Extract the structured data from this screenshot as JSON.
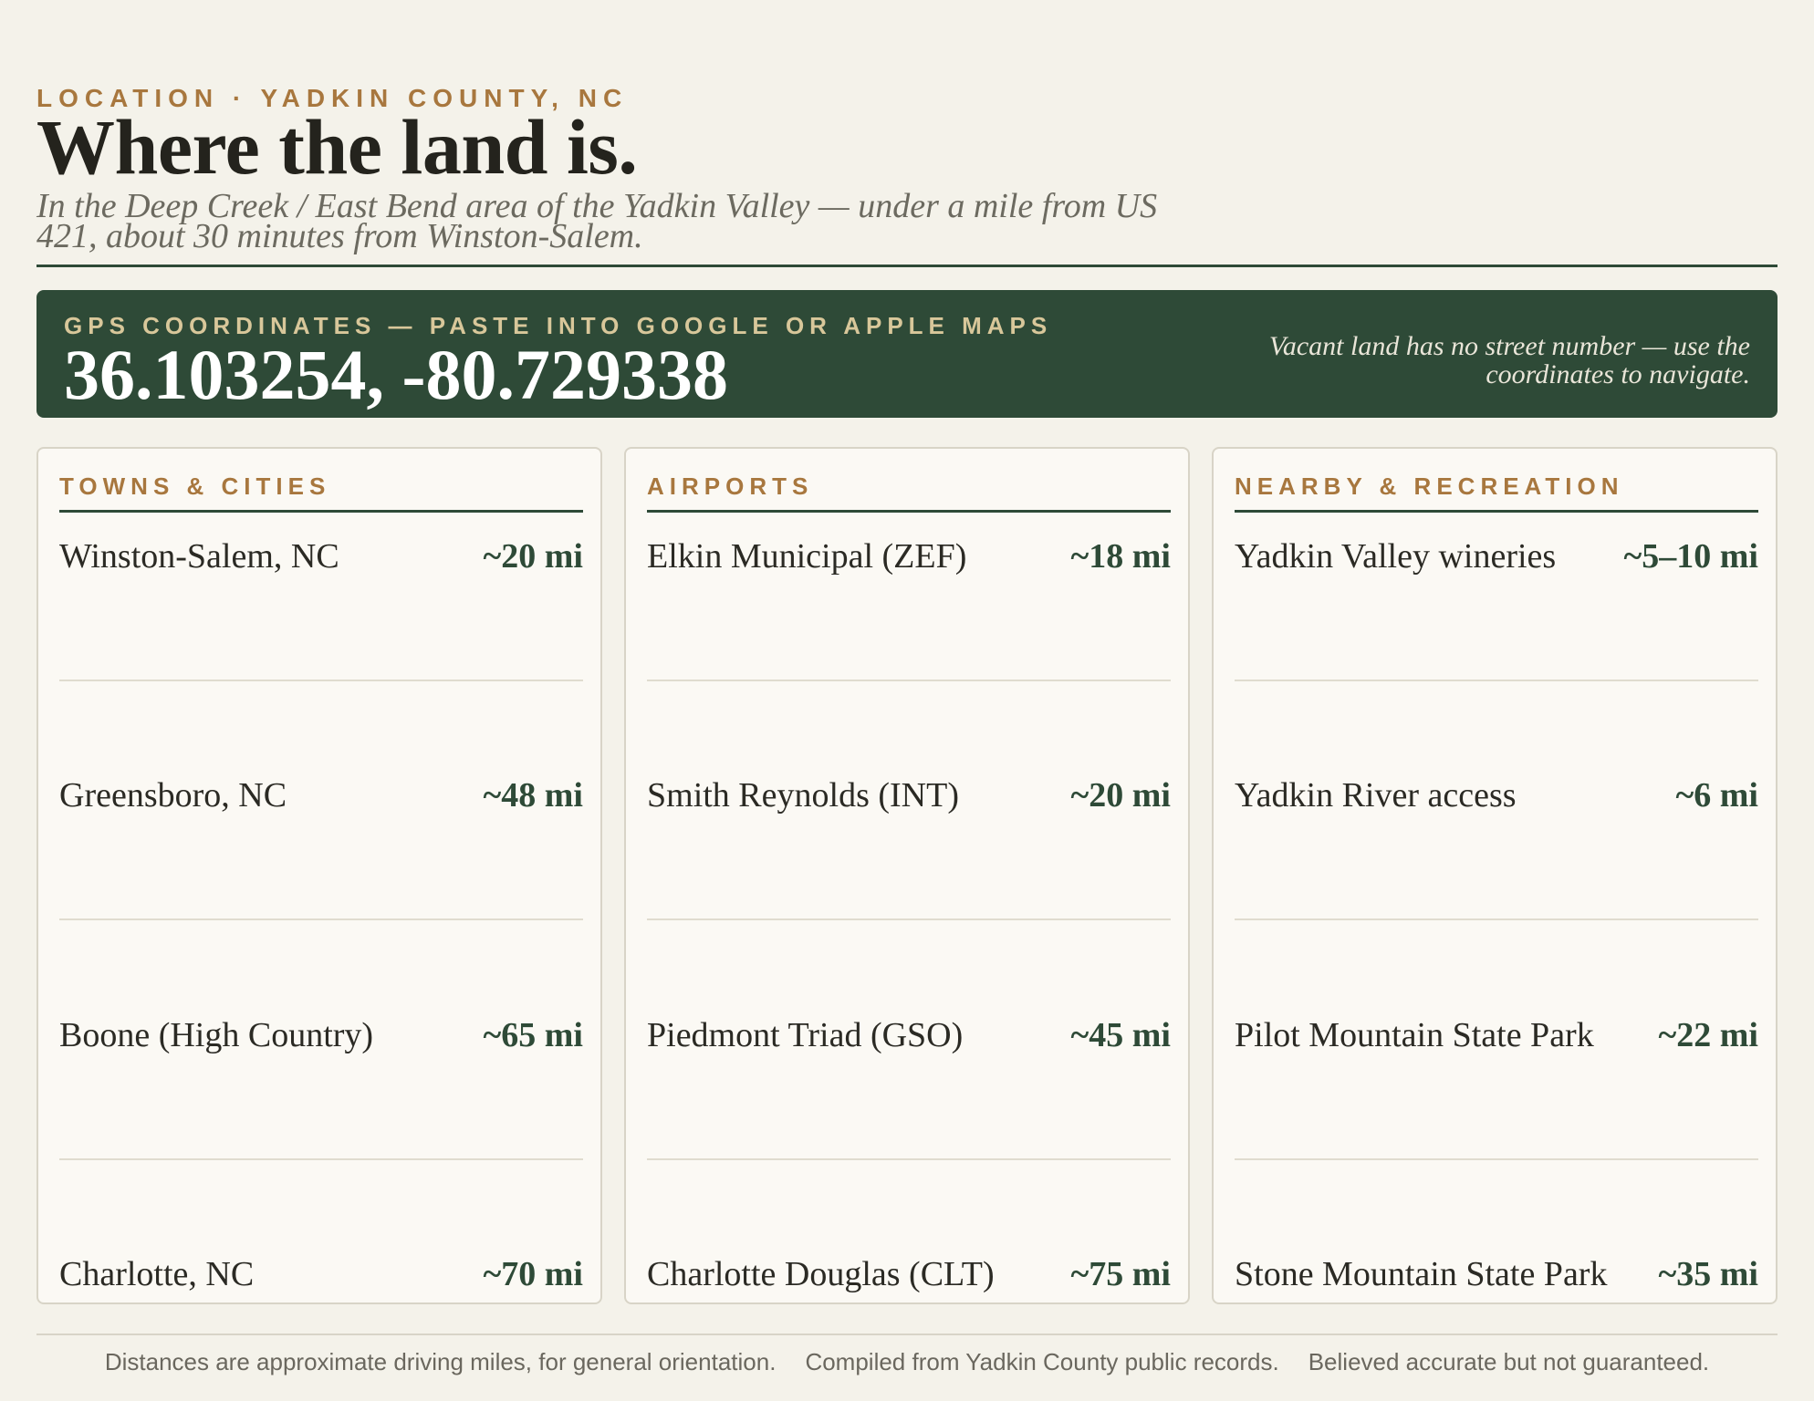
{
  "header": {
    "eyebrow": "LOCATION · YADKIN COUNTY, NC",
    "title": "Where the land is.",
    "subtitle": "In the Deep Creek / East Bend area of the Yadkin Valley — under a mile from US 421, about 30 minutes from Winston-Salem."
  },
  "gps": {
    "label": "GPS COORDINATES — PASTE INTO GOOGLE OR APPLE MAPS",
    "coordinates": "36.103254, -80.729338",
    "note": "Vacant land has no street number — use the coordinates to navigate."
  },
  "cards": [
    {
      "heading": "TOWNS & CITIES",
      "rows": [
        {
          "name": "Winston-Salem, NC",
          "distance": "~20 mi"
        },
        {
          "name": "Greensboro, NC",
          "distance": "~48 mi"
        },
        {
          "name": "Boone (High Country)",
          "distance": "~65 mi"
        },
        {
          "name": "Charlotte, NC",
          "distance": "~70 mi"
        }
      ]
    },
    {
      "heading": "AIRPORTS",
      "rows": [
        {
          "name": "Elkin Municipal (ZEF)",
          "distance": "~18 mi"
        },
        {
          "name": "Smith Reynolds (INT)",
          "distance": "~20 mi"
        },
        {
          "name": "Piedmont Triad (GSO)",
          "distance": "~45 mi"
        },
        {
          "name": "Charlotte Douglas (CLT)",
          "distance": "~75 mi"
        }
      ]
    },
    {
      "heading": "NEARBY & RECREATION",
      "rows": [
        {
          "name": "Yadkin Valley wineries",
          "distance": "~5–10 mi"
        },
        {
          "name": "Yadkin River access",
          "distance": "~6 mi"
        },
        {
          "name": "Pilot Mountain State Park",
          "distance": "~22 mi"
        },
        {
          "name": "Stone Mountain State Park",
          "distance": "~35 mi"
        }
      ]
    }
  ],
  "footer": {
    "note1": "Distances are approximate driving miles, for general orientation.",
    "note2": "Compiled from Yadkin County public records.",
    "note3": "Believed accurate but not guaranteed."
  }
}
